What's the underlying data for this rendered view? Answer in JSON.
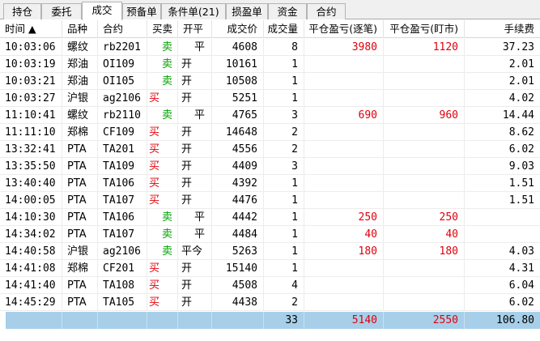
{
  "tabs": [
    {
      "label": "持仓"
    },
    {
      "label": "委托"
    },
    {
      "label": "成交"
    },
    {
      "label": "预备单"
    },
    {
      "label": "条件单(21)"
    },
    {
      "label": "损盈单"
    },
    {
      "label": "资金"
    },
    {
      "label": "合约"
    }
  ],
  "columns": {
    "time": "时间 ▲",
    "product": "品种",
    "contract": "合约",
    "side": "买卖",
    "open_close": "开平",
    "price": "成交价",
    "volume": "成交量",
    "pnl_fifo": "平仓盈亏(逐笔)",
    "pnl_mtm": "平仓盈亏(盯市)",
    "fee": "手续费"
  },
  "rows": [
    {
      "time": "10:03:06",
      "product": "螺纹",
      "contract": "rb2201",
      "side": "卖",
      "open_close": "平",
      "price": "4608",
      "volume": "8",
      "pnl_fifo": "3980",
      "pnl_mtm": "1120",
      "fee": "37.23"
    },
    {
      "time": "10:03:19",
      "product": "郑油",
      "contract": "OI109",
      "side": "卖",
      "open_close": "开",
      "price": "10161",
      "volume": "1",
      "pnl_fifo": "",
      "pnl_mtm": "",
      "fee": "2.01"
    },
    {
      "time": "10:03:21",
      "product": "郑油",
      "contract": "OI105",
      "side": "卖",
      "open_close": "开",
      "price": "10508",
      "volume": "1",
      "pnl_fifo": "",
      "pnl_mtm": "",
      "fee": "2.01"
    },
    {
      "time": "10:03:27",
      "product": "沪银",
      "contract": "ag2106",
      "side": "买",
      "open_close": "开",
      "price": "5251",
      "volume": "1",
      "pnl_fifo": "",
      "pnl_mtm": "",
      "fee": "4.02"
    },
    {
      "time": "11:10:41",
      "product": "螺纹",
      "contract": "rb2110",
      "side": "卖",
      "open_close": "平",
      "price": "4765",
      "volume": "3",
      "pnl_fifo": "690",
      "pnl_mtm": "960",
      "fee": "14.44"
    },
    {
      "time": "11:11:10",
      "product": "郑棉",
      "contract": "CF109",
      "side": "买",
      "open_close": "开",
      "price": "14648",
      "volume": "2",
      "pnl_fifo": "",
      "pnl_mtm": "",
      "fee": "8.62"
    },
    {
      "time": "13:32:41",
      "product": "PTA",
      "contract": "TA201",
      "side": "买",
      "open_close": "开",
      "price": "4556",
      "volume": "2",
      "pnl_fifo": "",
      "pnl_mtm": "",
      "fee": "6.02"
    },
    {
      "time": "13:35:50",
      "product": "PTA",
      "contract": "TA109",
      "side": "买",
      "open_close": "开",
      "price": "4409",
      "volume": "3",
      "pnl_fifo": "",
      "pnl_mtm": "",
      "fee": "9.03"
    },
    {
      "time": "13:40:40",
      "product": "PTA",
      "contract": "TA106",
      "side": "买",
      "open_close": "开",
      "price": "4392",
      "volume": "1",
      "pnl_fifo": "",
      "pnl_mtm": "",
      "fee": "1.51"
    },
    {
      "time": "14:00:05",
      "product": "PTA",
      "contract": "TA107",
      "side": "买",
      "open_close": "开",
      "price": "4476",
      "volume": "1",
      "pnl_fifo": "",
      "pnl_mtm": "",
      "fee": "1.51"
    },
    {
      "time": "14:10:30",
      "product": "PTA",
      "contract": "TA106",
      "side": "卖",
      "open_close": "平",
      "price": "4442",
      "volume": "1",
      "pnl_fifo": "250",
      "pnl_mtm": "250",
      "fee": ""
    },
    {
      "time": "14:34:02",
      "product": "PTA",
      "contract": "TA107",
      "side": "卖",
      "open_close": "平",
      "price": "4484",
      "volume": "1",
      "pnl_fifo": "40",
      "pnl_mtm": "40",
      "fee": ""
    },
    {
      "time": "14:40:58",
      "product": "沪银",
      "contract": "ag2106",
      "side": "卖",
      "open_close": "平今",
      "price": "5263",
      "volume": "1",
      "pnl_fifo": "180",
      "pnl_mtm": "180",
      "fee": "4.03"
    },
    {
      "time": "14:41:08",
      "product": "郑棉",
      "contract": "CF201",
      "side": "买",
      "open_close": "开",
      "price": "15140",
      "volume": "1",
      "pnl_fifo": "",
      "pnl_mtm": "",
      "fee": "4.31"
    },
    {
      "time": "14:41:40",
      "product": "PTA",
      "contract": "TA108",
      "side": "买",
      "open_close": "开",
      "price": "4508",
      "volume": "4",
      "pnl_fifo": "",
      "pnl_mtm": "",
      "fee": "6.04"
    },
    {
      "time": "14:45:29",
      "product": "PTA",
      "contract": "TA105",
      "side": "买",
      "open_close": "开",
      "price": "4438",
      "volume": "2",
      "pnl_fifo": "",
      "pnl_mtm": "",
      "fee": "6.02"
    }
  ],
  "totals": {
    "volume": "33",
    "pnl_fifo": "5140",
    "pnl_mtm": "2550",
    "fee": "106.80"
  },
  "colors": {
    "buy": "#e0000b",
    "sell": "#00a000",
    "profit": "#e0000b",
    "total_bg": "#a7cfe9"
  }
}
